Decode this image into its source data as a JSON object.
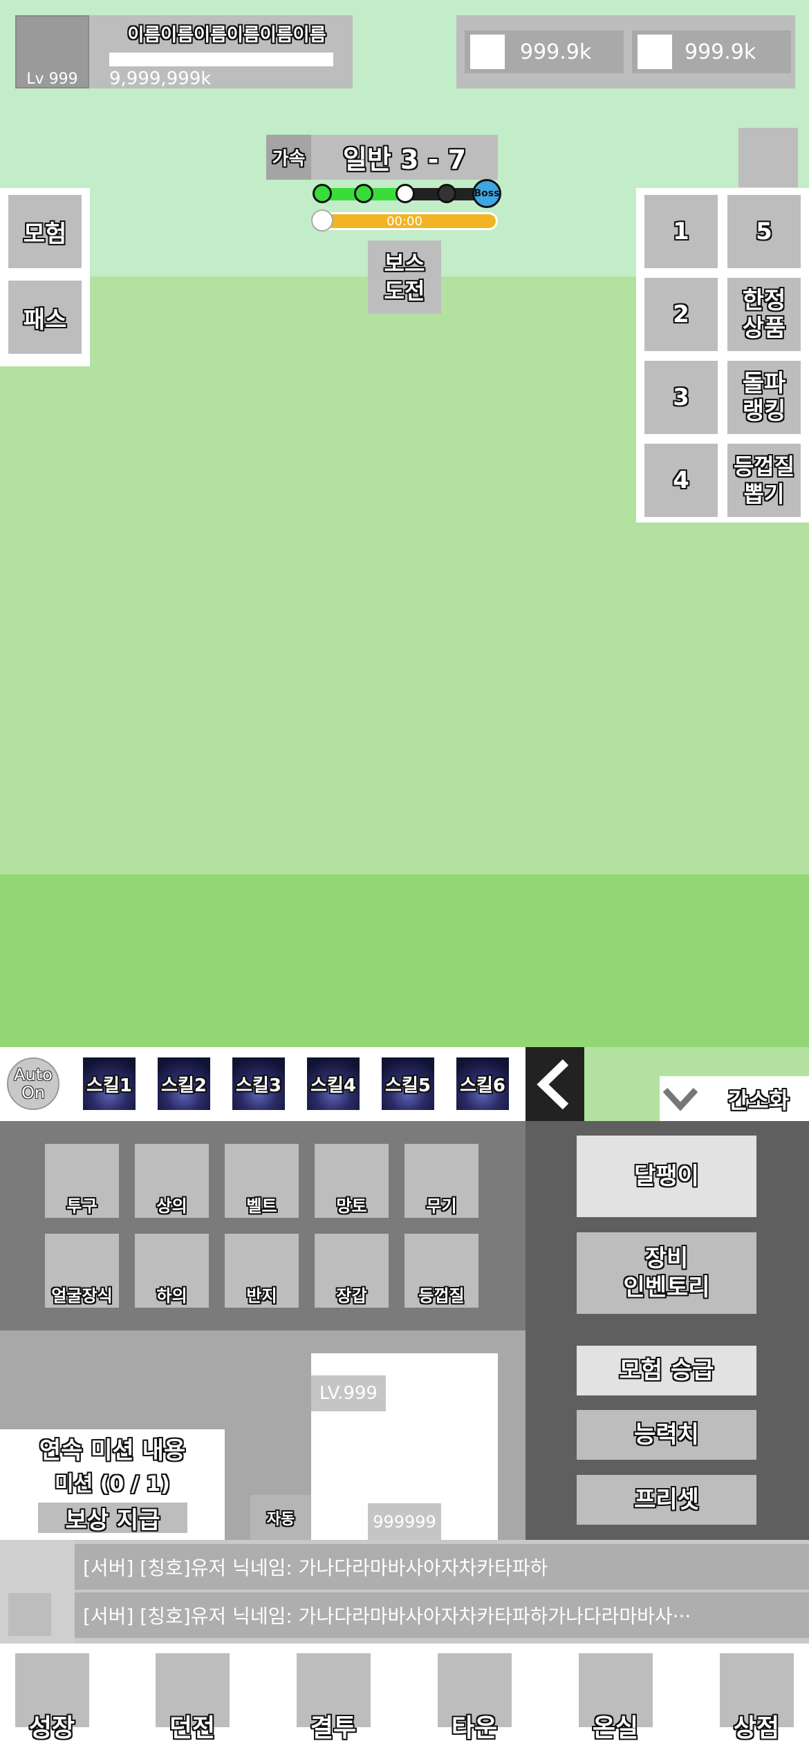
{
  "profile": {
    "level": "Lv 999",
    "name": "이름이름이름이름이름이름",
    "exp": "9,999,999k"
  },
  "currency": [
    {
      "value": "999.9k"
    },
    {
      "value": "999.9k"
    }
  ],
  "stage": {
    "speed_label": "가속",
    "title": "일반 3 - 7",
    "boss_marker": "Boss",
    "timer": "00:00",
    "progress_cleared": 2,
    "progress_total": 5,
    "boss_button": "보스\n도전"
  },
  "left_menu": [
    "모험",
    "패스"
  ],
  "right_menu": [
    {
      "col1": "1",
      "col2": "5"
    },
    {
      "col1": "2",
      "col2": "한정\n상품"
    },
    {
      "col1": "3",
      "col2": "돌파\n랭킹"
    },
    {
      "col1": "4",
      "col2": "등껍질\n뽑기"
    }
  ],
  "skillbar": {
    "auto": "Auto\nOn",
    "skills": [
      "스킬1",
      "스킬2",
      "스킬3",
      "스킬4",
      "스킬5",
      "스킬6"
    ],
    "simplify": "간소화"
  },
  "equipment": {
    "row1": [
      "투구",
      "상의",
      "벨트",
      "망토",
      "무기"
    ],
    "row2": [
      "얼굴장식",
      "하의",
      "반지",
      "장갑",
      "등껍질"
    ]
  },
  "right_buttons": {
    "snail": "달팽이",
    "inventory": "장비\n인벤토리",
    "promote": "모험 승급",
    "stats": "능력치",
    "preset": "프리셋"
  },
  "character": {
    "level": "LV.999",
    "value": "999999",
    "auto_label": "자동"
  },
  "mission": {
    "title": "연속 미션 내용",
    "progress": "미션 (0 / 1)",
    "reward_button": "보상 지급"
  },
  "chat": [
    "[서버] [칭호]유저 닉네임:   가나다라마바사아자차카타파하",
    "[서버] [칭호]유저 닉네임:   가나다라마바사아자차카타파하가나다라마바사···"
  ],
  "nav": [
    "성장",
    "던전",
    "결투",
    "타운",
    "온실",
    "상점"
  ],
  "colors": {
    "accent_green": "#3adc3a",
    "timer_orange": "#f1b425",
    "boss_blue": "#3ea6e0"
  }
}
